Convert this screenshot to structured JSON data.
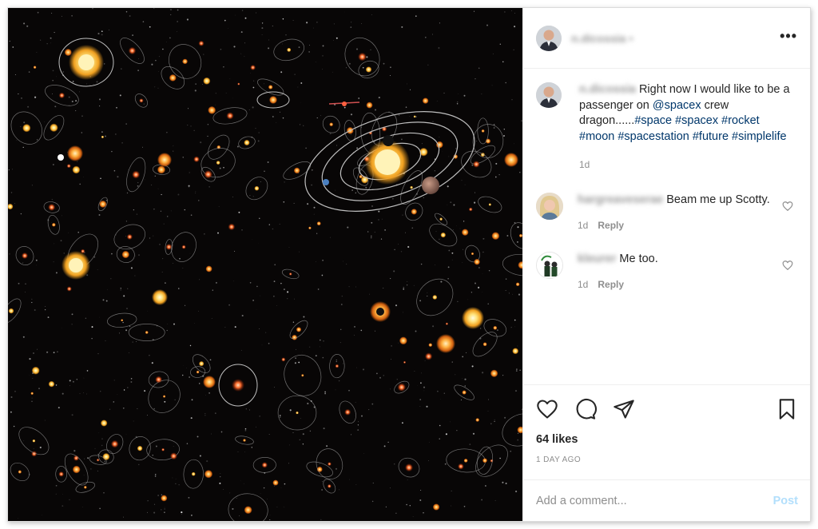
{
  "post": {
    "author_handle": "n.dicossia",
    "follow_marker": "•",
    "more_label": "•••",
    "image_alt": "Artist's illustration of many star systems with orbiting planets"
  },
  "caption": {
    "user": "n.dicossia",
    "text_pre": "Right now I would like to be a passenger on ",
    "mention": "@spacex",
    "text_mid": " crew dragon......",
    "hashtags": "#space #spacex #rocket #moon #spacestation #future #simplelife",
    "age": "1d"
  },
  "comments": [
    {
      "user": "hargreaveserae",
      "text": "Beam me up Scotty.",
      "age": "1d",
      "reply_label": "Reply"
    },
    {
      "user": "kleurer",
      "text": "Me too.",
      "age": "1d",
      "reply_label": "Reply"
    }
  ],
  "actions": {
    "likes_text": "64 likes",
    "timestamp": "1 DAY AGO"
  },
  "add_comment": {
    "placeholder": "Add a comment...",
    "post_label": "Post"
  },
  "icons": {
    "like": "heart-icon",
    "comment": "comment-bubble-icon",
    "share": "paper-plane-icon",
    "save": "bookmark-icon",
    "options": "more-options-icon"
  },
  "colors": {
    "link": "#00376b",
    "muted": "#8e8e8e",
    "post_disabled": "#b2dffc",
    "border": "#efefef"
  }
}
